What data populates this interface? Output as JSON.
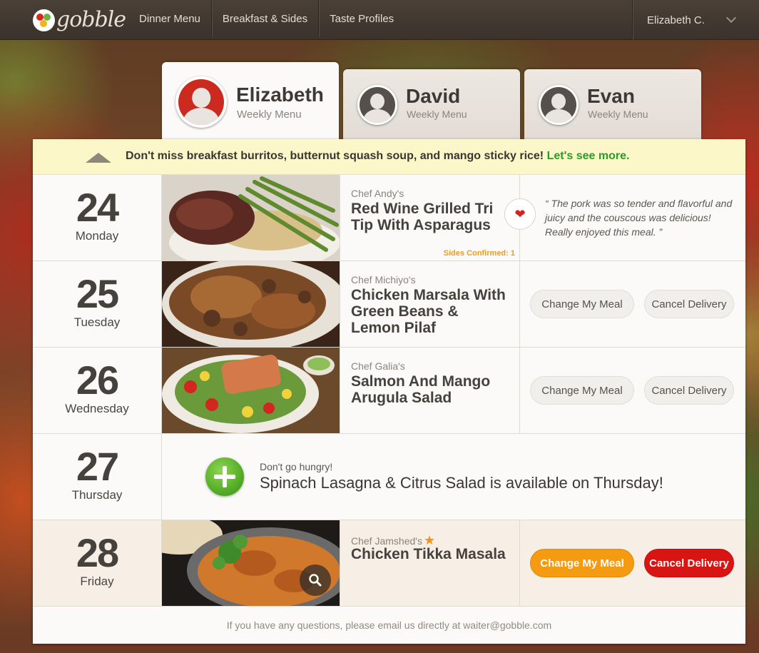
{
  "nav": {
    "logo_text": "gobble",
    "links": [
      "Dinner Menu",
      "Breakfast & Sides",
      "Taste Profiles"
    ],
    "user_name": "Elizabeth C."
  },
  "tabs": [
    {
      "name": "Elizabeth",
      "sub": "Weekly Menu",
      "active": true
    },
    {
      "name": "David",
      "sub": "Weekly Menu",
      "active": false
    },
    {
      "name": "Evan",
      "sub": "Weekly Menu",
      "active": false
    }
  ],
  "promo": {
    "text": "Don't miss breakfast burritos, butternut squash soup, and mango sticky rice!",
    "link": "Let's see more."
  },
  "days": [
    {
      "date": "24",
      "weekday": "Monday",
      "chef": "Chef Andy's",
      "meal": "Red Wine Grilled Tri Tip With Asparagus",
      "sides": "Sides Confirmed: 1",
      "review": "“ The pork was so tender and flavorful and juicy and the couscous was delicious! Really enjoyed this meal. ”"
    },
    {
      "date": "25",
      "weekday": "Tuesday",
      "chef": "Chef Michiyo's",
      "meal": "Chicken Marsala With Green Beans & Lemon Pilaf",
      "change_label": "Change My Meal",
      "cancel_label": "Cancel Delivery"
    },
    {
      "date": "26",
      "weekday": "Wednesday",
      "chef": "Chef Galia's",
      "meal": "Salmon And Mango Arugula Salad",
      "change_label": "Change My Meal",
      "cancel_label": "Cancel Delivery"
    },
    {
      "date": "27",
      "weekday": "Thursday",
      "add_small": "Don't go hungry!",
      "add_big": "Spinach Lasagna & Citrus Salad is available on Thursday!"
    },
    {
      "date": "28",
      "weekday": "Friday",
      "chef": "Chef Jamshed's",
      "meal": "Chicken Tikka Masala",
      "change_label": "Change My Meal",
      "cancel_label": "Cancel Delivery"
    }
  ],
  "footer": "If you have any questions, please email us directly at waiter@gobble.com",
  "colors": {
    "accent_green": "#2e9a26",
    "orange": "#f59b12",
    "red": "#d81512",
    "sides_orange": "#ef9a1e"
  }
}
